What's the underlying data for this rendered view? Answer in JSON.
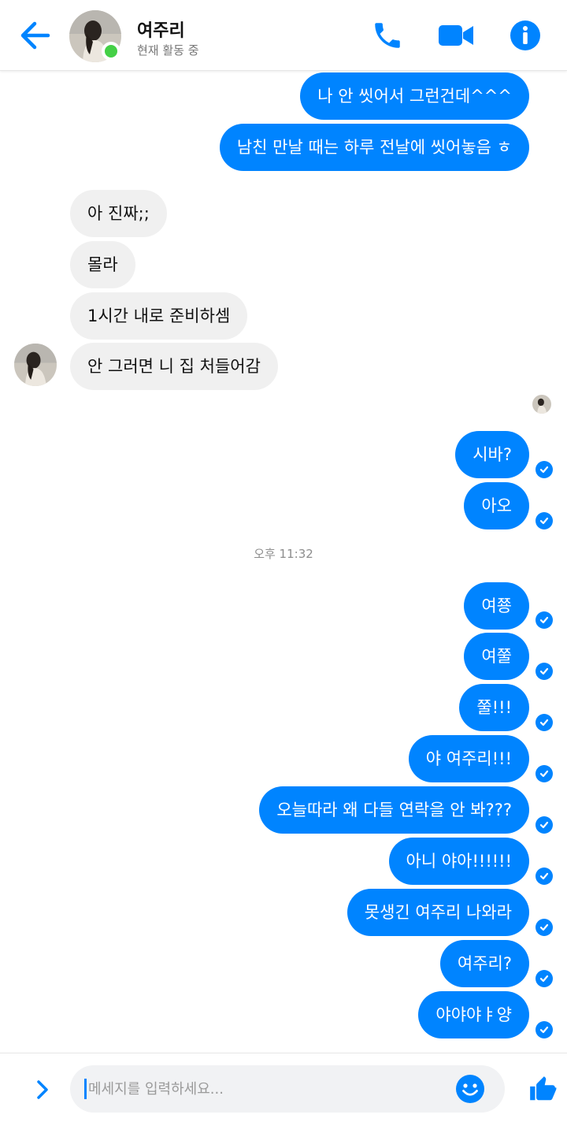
{
  "header": {
    "contact_name": "여주리",
    "status": "현재 활동 중",
    "icons": [
      "back-arrow-icon",
      "phone-icon",
      "video-camera-icon",
      "info-icon"
    ],
    "accent_color": "#0084ff",
    "online_color": "#44d046"
  },
  "messages": [
    {
      "dir": "out",
      "text": "나 안 씻어서 그런건데^^^",
      "read": false
    },
    {
      "dir": "out",
      "text": "남친 만날 때는 하루 전날에 씻어놓음 ㅎ",
      "read": false
    },
    {
      "dir": "in",
      "text": "아 진짜;;"
    },
    {
      "dir": "in",
      "text": "몰라"
    },
    {
      "dir": "in",
      "text": "1시간 내로 준비하셈"
    },
    {
      "dir": "in",
      "text": "안 그러면 니 집 처들어감"
    },
    {
      "dir": "out",
      "text": "시바?",
      "read": true
    },
    {
      "dir": "out",
      "text": "아오",
      "read": true
    },
    {
      "dir": "out",
      "text": "여쭁",
      "read": true
    },
    {
      "dir": "out",
      "text": "여쭐",
      "read": true
    },
    {
      "dir": "out",
      "text": "쭐!!!",
      "read": true
    },
    {
      "dir": "out",
      "text": "야 여주리!!!",
      "read": true
    },
    {
      "dir": "out",
      "text": "오늘따라 왜 다들 연락을 안 봐???",
      "read": true
    },
    {
      "dir": "out",
      "text": "아니 야아!!!!!!",
      "read": true
    },
    {
      "dir": "out",
      "text": "못생긴 여주리 나와라",
      "read": true
    },
    {
      "dir": "out",
      "text": "여주리?",
      "read": true
    },
    {
      "dir": "out",
      "text": "야야야ㅑ양",
      "read": true
    }
  ],
  "timestamp": "오후 11:32",
  "composer": {
    "placeholder": "메세지를 입력하세요...",
    "value": "",
    "icons": [
      "chevron-right-icon",
      "emoji-icon",
      "thumbs-up-icon"
    ]
  },
  "colors": {
    "outgoing_bubble": "#0084ff",
    "incoming_bubble": "#f0f0f0"
  }
}
